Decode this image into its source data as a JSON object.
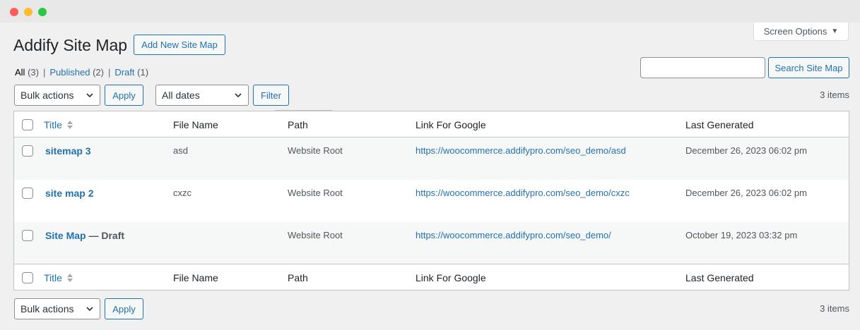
{
  "screen_options": {
    "label": "Screen Options"
  },
  "page": {
    "title": "Addify Site Map",
    "add_new_label": "Add New Site Map"
  },
  "views": {
    "all": {
      "label": "All",
      "count": "(3)"
    },
    "published": {
      "label": "Published",
      "count": "(2)"
    },
    "draft": {
      "label": "Draft",
      "count": "(1)"
    },
    "separator": "|"
  },
  "search": {
    "value": "",
    "button_label": "Search Site Map"
  },
  "top_nav": {
    "bulk_actions": "Bulk actions",
    "apply_label": "Apply",
    "dates": "All dates",
    "filter_label": "Filter",
    "items_count": "3 items"
  },
  "table": {
    "columns": {
      "title": "Title",
      "file_name": "File Name",
      "path": "Path",
      "link": "Link For Google",
      "last_generated": "Last Generated"
    },
    "rows": [
      {
        "title": "sitemap 3",
        "state": "",
        "file_name": "asd",
        "path": "Website Root",
        "link": "https://woocommerce.addifypro.com/seo_demo/asd",
        "last_generated": "December 26, 2023 06:02 pm"
      },
      {
        "title": "site map 2",
        "state": "",
        "file_name": "cxzc",
        "path": "Website Root",
        "link": "https://woocommerce.addifypro.com/seo_demo/cxzc",
        "last_generated": "December 26, 2023 06:02 pm"
      },
      {
        "title": "Site Map",
        "state": " — Draft",
        "file_name": "",
        "path": "Website Root",
        "link": "https://woocommerce.addifypro.com/seo_demo/",
        "last_generated": "October 19, 2023 03:32 pm"
      }
    ]
  },
  "bottom_nav": {
    "bulk_actions": "Bulk actions",
    "apply_label": "Apply",
    "items_count": "3 items"
  },
  "icons": {
    "window_controls": [
      "close-dot",
      "minimize-dot",
      "maximize-dot"
    ],
    "sort": "sort-arrows-icon",
    "dropdown": "chevron-down-icon"
  },
  "colors": {
    "accent": "#2271b1",
    "background": "#f0f0f1",
    "text": "#1d2327"
  }
}
